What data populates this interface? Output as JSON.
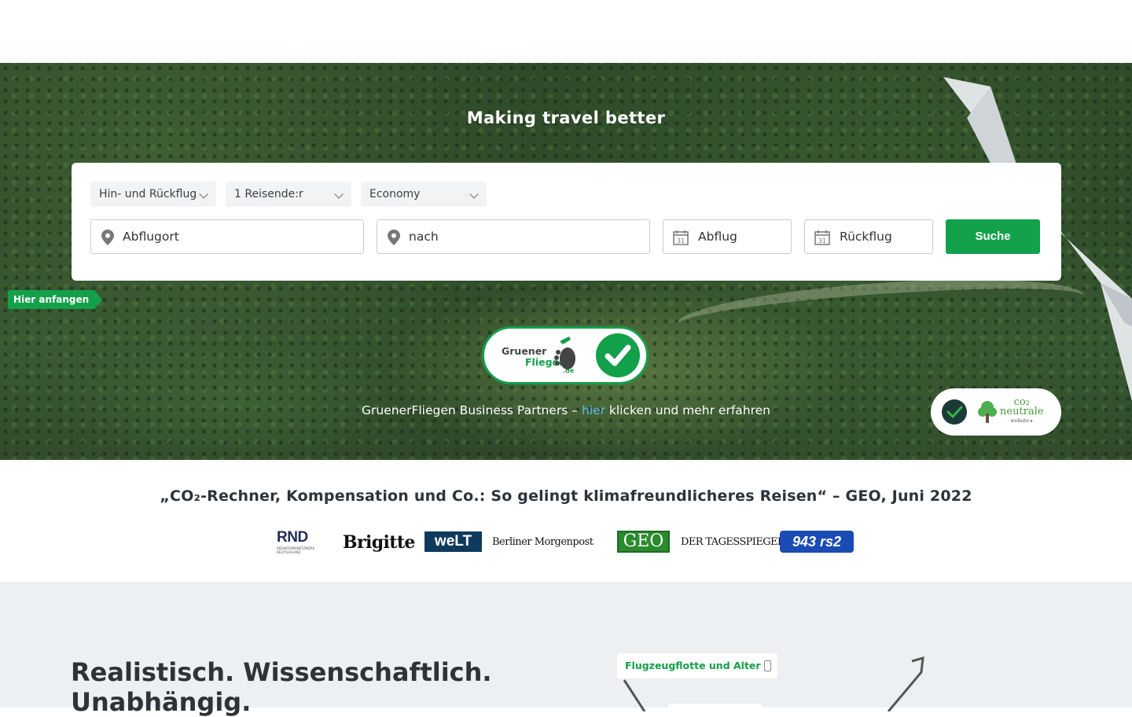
{
  "hero": {
    "title": "Making travel better"
  },
  "search": {
    "trip_type": "Hin- und Rückflug",
    "travellers": "1 Reisende:r",
    "cabin": "Economy",
    "origin_placeholder": "Abflugort",
    "destination_placeholder": "nach",
    "departure_placeholder": "Abflug",
    "return_placeholder": "Rückflug",
    "calendar_day": "31",
    "search_label": "Suche",
    "start_tag": "Hier anfangen"
  },
  "badge": {
    "line1": "Gruener",
    "line2": "Fliegen",
    "line3": ".de"
  },
  "partners": {
    "prefix": "GruenerFliegen Business Partners – ",
    "link": "hier",
    "suffix": " klicken und mehr erfahren"
  },
  "co2_badge": {
    "line1": "co₂",
    "line2": "neutrale",
    "line3": "website ▸"
  },
  "press": {
    "quote": "„CO₂-Rechner, Kompensation und Co.: So gelingt klimafreundlicheres Reisen“ – GEO, Juni 2022",
    "logos": [
      "RND",
      "Brigitte",
      "weLT",
      "Berliner Morgenpost",
      "GEO",
      "DER TAGESSPIEGEL",
      "943 rs2"
    ],
    "rnd_sub": "REDAKTIONSNETZWERK DEUTSCHLAND"
  },
  "features": {
    "heading": "Realistisch. Wissenschaftlich. Unabhängig.",
    "fleet_tag": "Flugzeugflotte und Alter"
  },
  "colors": {
    "brand_green": "#13a04a",
    "link_blue": "#5ab8e8",
    "section_grey": "#edf0f2"
  }
}
